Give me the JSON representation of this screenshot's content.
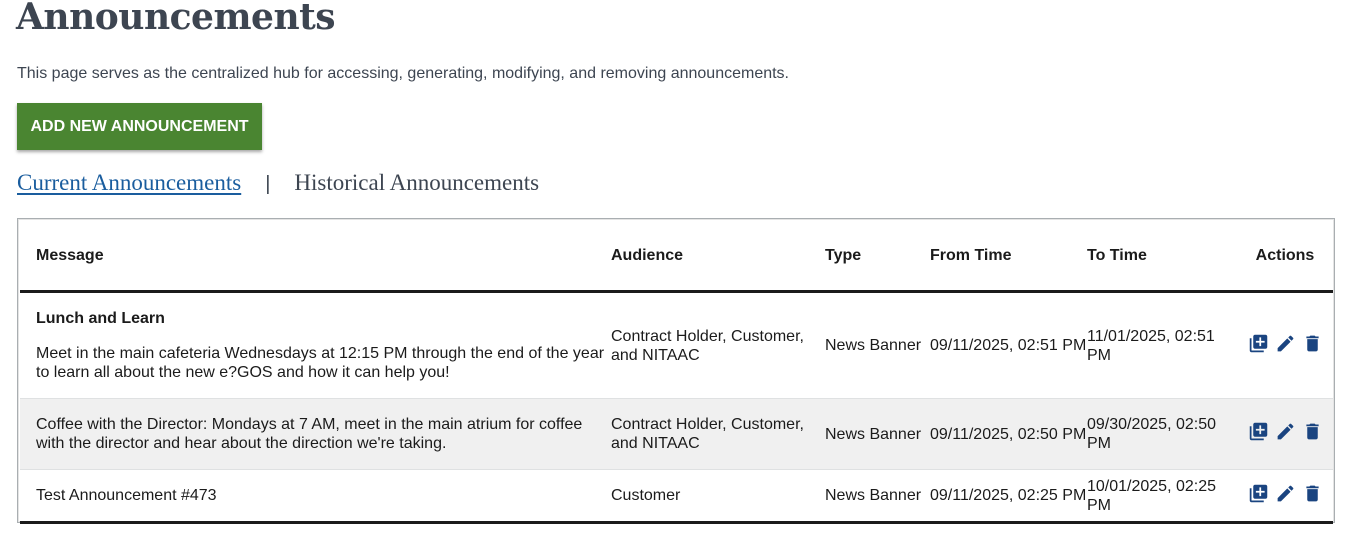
{
  "page": {
    "title": "Announcements",
    "intro": "This page serves as the centralized hub for accessing, generating, modifying, and removing announcements.",
    "add_button": "ADD NEW ANNOUNCEMENT"
  },
  "tabs": {
    "current": "Current Announcements",
    "separator": "|",
    "historical": "Historical Announcements"
  },
  "table": {
    "headers": {
      "message": "Message",
      "audience": "Audience",
      "type": "Type",
      "from": "From Time",
      "to": "To Time",
      "actions": "Actions"
    },
    "rows": [
      {
        "title": "Lunch and Learn",
        "message": "Meet in the main cafeteria Wednesdays at 12:15 PM through the end of the year to learn all about the new e?GOS and how it can help you!",
        "audience": "Contract Holder, Customer, and NITAAC",
        "type": "News Banner",
        "from": "09/11/2025, 02:51 PM",
        "to": "11/01/2025, 02:51 PM"
      },
      {
        "title": "",
        "message": "Coffee with the Director: Mondays at 7 AM, meet in the main atrium for coffee with the director and hear about the direction we're taking.",
        "audience": "Contract Holder, Customer, and NITAAC",
        "type": "News Banner",
        "from": "09/11/2025, 02:50 PM",
        "to": "09/30/2025, 02:50 PM"
      },
      {
        "title": "",
        "message": "Test Announcement #473",
        "audience": "Customer",
        "type": "News Banner",
        "from": "09/11/2025, 02:25 PM",
        "to": "10/01/2025, 02:25 PM"
      }
    ],
    "action_icons": [
      "add-to-library-icon",
      "pencil-icon",
      "trash-icon"
    ]
  },
  "colors": {
    "primary_button": "#4a8531",
    "link": "#1a5d9e",
    "icon": "#1a4480",
    "striped_row": "#f0f0f0",
    "heading": "#3d4551"
  }
}
